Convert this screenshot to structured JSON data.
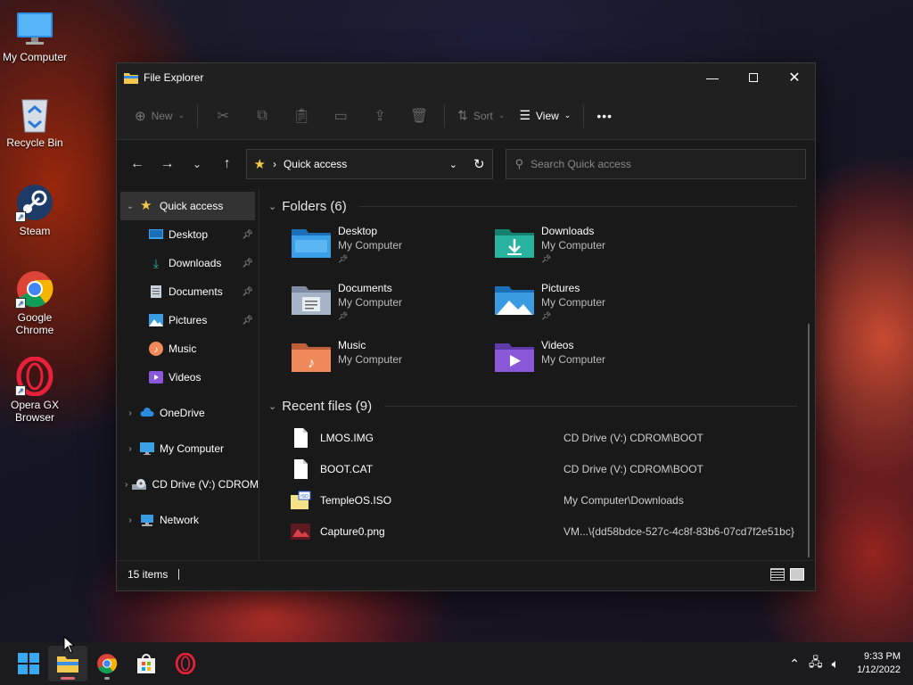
{
  "desktop": {
    "icons": [
      {
        "label": "My Computer",
        "icon": "monitor-icon"
      },
      {
        "label": "Recycle Bin",
        "icon": "recycle-bin-icon"
      },
      {
        "label": "Steam",
        "icon": "steam-icon"
      },
      {
        "label": "Google Chrome",
        "icon": "chrome-icon"
      },
      {
        "label": "Opera GX Browser",
        "icon": "opera-gx-icon"
      }
    ]
  },
  "window": {
    "title": "File Explorer",
    "toolbar": {
      "new_label": "New",
      "sort_label": "Sort",
      "view_label": "View",
      "more_label": "•••"
    },
    "address": {
      "location": "Quick access",
      "separator": "›"
    },
    "search": {
      "placeholder": "Search Quick access"
    },
    "sidebar": {
      "quick_access": "Quick access",
      "items": [
        {
          "label": "Desktop",
          "pinned": true
        },
        {
          "label": "Downloads",
          "pinned": true
        },
        {
          "label": "Documents",
          "pinned": true
        },
        {
          "label": "Pictures",
          "pinned": true
        },
        {
          "label": "Music",
          "pinned": false
        },
        {
          "label": "Videos",
          "pinned": false
        }
      ],
      "roots": [
        {
          "label": "OneDrive"
        },
        {
          "label": "My Computer"
        },
        {
          "label": "CD Drive (V:) CDROM"
        },
        {
          "label": "Network"
        }
      ]
    },
    "folders_header": "Folders (6)",
    "folders": [
      {
        "name": "Desktop",
        "location": "My Computer",
        "pinned": true,
        "color": "#3aa0e8"
      },
      {
        "name": "Downloads",
        "location": "My Computer",
        "pinned": true,
        "color": "#27b3a0"
      },
      {
        "name": "Documents",
        "location": "My Computer",
        "pinned": true,
        "color": "#a7b4c8"
      },
      {
        "name": "Pictures",
        "location": "My Computer",
        "pinned": true,
        "color": "#3a9be0"
      },
      {
        "name": "Music",
        "location": "My Computer",
        "pinned": false,
        "color": "#f08a5a"
      },
      {
        "name": "Videos",
        "location": "My Computer",
        "pinned": false,
        "color": "#8a58d8"
      }
    ],
    "recent_header": "Recent files (9)",
    "recent_files": [
      {
        "name": "LMOS.IMG",
        "location": "CD Drive (V:) CDROM\\BOOT",
        "icon": "file-icon"
      },
      {
        "name": "BOOT.CAT",
        "location": "CD Drive (V:) CDROM\\BOOT",
        "icon": "file-icon"
      },
      {
        "name": "TempleOS.ISO",
        "location": "My Computer\\Downloads",
        "icon": "iso-icon"
      },
      {
        "name": "Capture0.png",
        "location": "VM...\\{dd58bdce-527c-4c8f-83b6-07cd7f2e51bc}",
        "icon": "image-icon"
      }
    ],
    "status": {
      "items": "15 items"
    }
  },
  "taskbar": {
    "clock_time": "9:33 PM",
    "clock_date": "1/12/2022"
  },
  "colors": {
    "accent_pink": "#e06a72",
    "folder_yellow": "#f2c94c"
  }
}
